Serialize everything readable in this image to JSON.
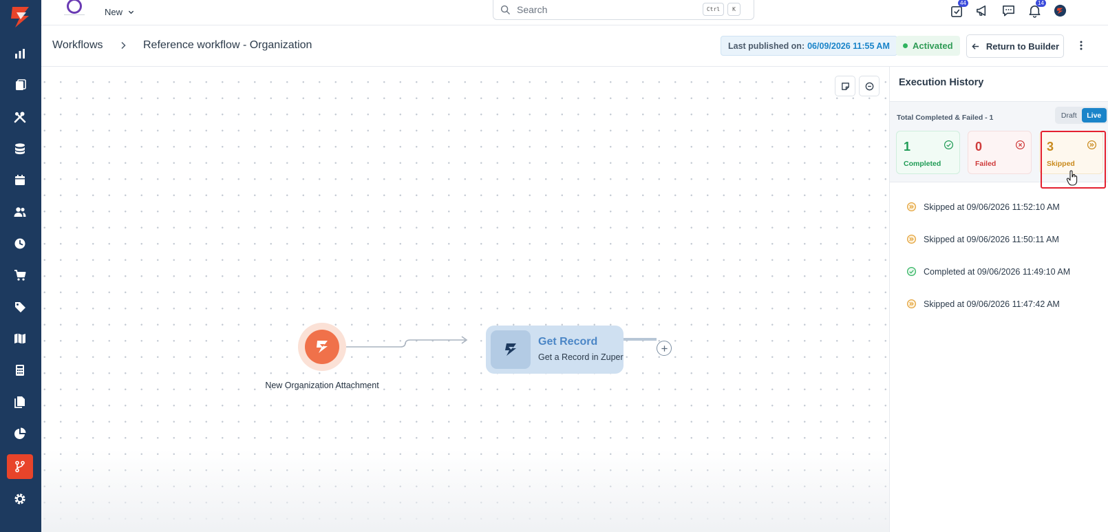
{
  "app": {
    "new_label": "New",
    "search": {
      "placeholder": "Search",
      "shortcut_ctrl": "Ctrl",
      "shortcut_key": "K"
    },
    "notifications": {
      "tasks_count": "44",
      "bell_count": "14"
    }
  },
  "sidebar": {
    "items": [
      {
        "icon": "dashboard-icon"
      },
      {
        "icon": "jobs-icon"
      },
      {
        "icon": "tools-icon"
      },
      {
        "icon": "stack-icon"
      },
      {
        "icon": "calendar-icon"
      },
      {
        "icon": "users-icon"
      },
      {
        "icon": "timesheet-icon"
      },
      {
        "icon": "cart-icon"
      },
      {
        "icon": "tag-icon"
      },
      {
        "icon": "map-icon"
      },
      {
        "icon": "calculator-icon"
      },
      {
        "icon": "documents-icon"
      },
      {
        "icon": "reports-icon"
      },
      {
        "icon": "workflow-icon",
        "active": true
      },
      {
        "icon": "settings-icon"
      }
    ]
  },
  "header": {
    "breadcrumb_root": "Workflows",
    "breadcrumb_current": "Reference workflow - Organization",
    "published_label": "Last published on:",
    "published_value": "06/09/2026 11:55 AM",
    "status": "Activated",
    "return_button": "Return to Builder"
  },
  "canvas": {
    "trigger_label": "New Organization Attachment",
    "action_title": "Get Record",
    "action_subtitle": "Get a Record in Zuper"
  },
  "panel": {
    "title": "Execution History",
    "total_label": "Total Completed & Failed - 1",
    "toggle": {
      "draft": "Draft",
      "live": "Live",
      "selected": "live"
    },
    "stats": {
      "completed": {
        "count": "1",
        "label": "Completed"
      },
      "failed": {
        "count": "0",
        "label": "Failed"
      },
      "skipped": {
        "count": "3",
        "label": "Skipped"
      }
    },
    "history": [
      {
        "status": "skipped",
        "text": "Skipped at 09/06/2026 11:52:10 AM"
      },
      {
        "status": "skipped",
        "text": "Skipped at 09/06/2026 11:50:11 AM"
      },
      {
        "status": "completed",
        "text": "Completed at 09/06/2026 11:49:10 AM"
      },
      {
        "status": "skipped",
        "text": "Skipped at 09/06/2026 11:47:42 AM"
      }
    ]
  },
  "colors": {
    "sidebar_bg": "#1d3a5f",
    "brand_orange": "#e8442a",
    "accent_blue": "#1a84c9",
    "success_green": "#1f9b55",
    "failed_red": "#cf3b3b",
    "skipped_amber": "#c98a1d"
  }
}
